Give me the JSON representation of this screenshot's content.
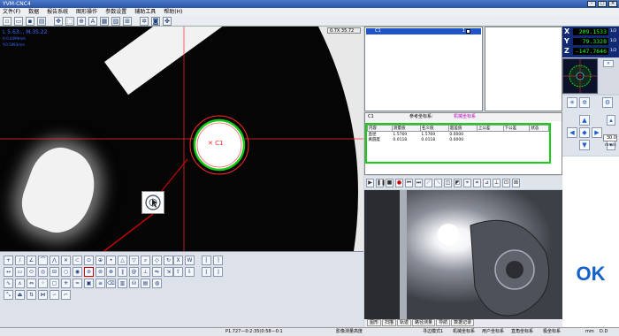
{
  "window": {
    "title": "YVM-CNC4"
  },
  "menu": [
    "文件(F)",
    "数据",
    "报告系统",
    "图形操作",
    "参数设置",
    "辅助工具",
    "帮助(H)"
  ],
  "camera": {
    "readout_line1": "L  5.63...  M.35.22",
    "readout_line2": "X:0.4499mm",
    "readout_line3": "Y:0.5993mm",
    "zoom": "0.7X 35.72"
  },
  "list": {
    "item": "C1",
    "index": "1"
  },
  "coord": {
    "name": "C1",
    "ref_label": "参考坐标系:",
    "ref_value": "机械坐标系",
    "columns": [
      "内容",
      "测量值",
      "名义值",
      "超差值",
      "上公差",
      "下公差",
      "状态"
    ],
    "rows": [
      {
        "name": "直径",
        "measured": "1.5769",
        "nominal": "1.5769",
        "deviation": "0.0000"
      },
      {
        "name": "真圆度",
        "measured": "0.0118",
        "nominal": "0.0118",
        "deviation": "0.0000"
      }
    ]
  },
  "dro": {
    "x": {
      "axis": "X",
      "value": "209.1533",
      "unit": "1/2"
    },
    "y": {
      "axis": "Y",
      "value": "79.3328",
      "unit": "1/2"
    },
    "z": {
      "axis": "Z",
      "value": "-147.7646",
      "unit": "1/2"
    }
  },
  "speed": {
    "value": "30.0",
    "unit": "mm/s"
  },
  "preview_tabs": [
    "图形",
    "扫描",
    "轨迹",
    "路径测量",
    "导航",
    "数据记录"
  ],
  "status": {
    "position": "P1.727—0:2:35(0:58—0:1",
    "hint": "影像测量高度",
    "mode": "寻边模式1",
    "coord1": "机械坐标系",
    "coord2": "用户坐标系",
    "coord3": "直角坐标系",
    "coord4": "极坐标系",
    "unit": "mm",
    "deg": "D.D"
  },
  "ok_label": "OK",
  "colors": {
    "accent": "#1f55c8",
    "dro_text": "#23ff23",
    "ok": "#1361c9",
    "crosshair": "#ff2a2a",
    "highlight": "#15d015"
  },
  "icons": {
    "selected_tool": "circle-measure-icon",
    "callout": "circle-measure-icon"
  }
}
